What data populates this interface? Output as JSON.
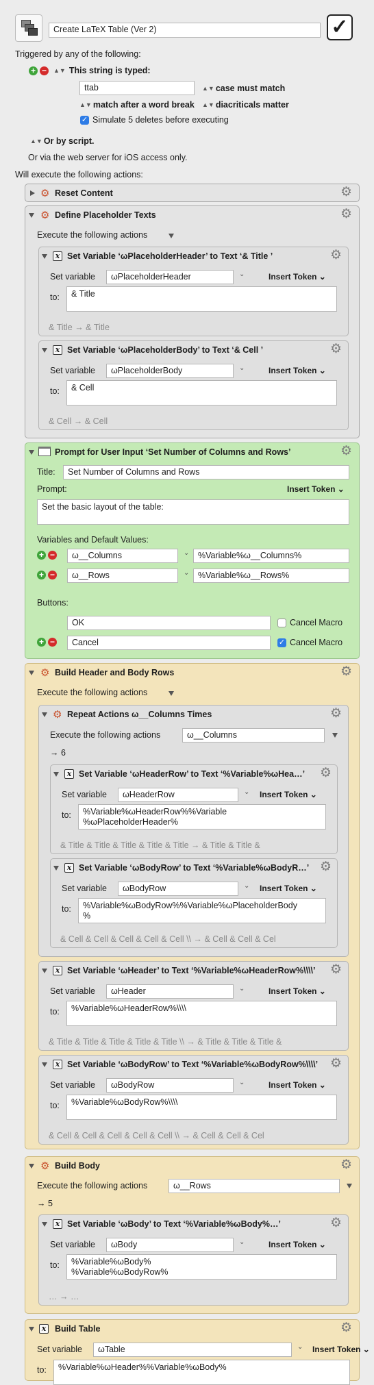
{
  "macro": {
    "name": "Create LaTeX Table (Ver 2)",
    "enabled": true
  },
  "triggers": {
    "header": "Triggered by any of the following:",
    "string_typed": "This string is typed:",
    "string": "ttab",
    "case": "case must match",
    "word_break": "match after a word break",
    "diacriticals": "diacriticals matter",
    "simulate": "Simulate 5 deletes before executing",
    "or_script": "Or by script.",
    "web": "Or via the web server for iOS access only."
  },
  "will_execute": "Will execute the following actions:",
  "insert_token": "Insert Token",
  "set_variable": "Set variable",
  "to_label": "to:",
  "execute_label": "Execute the following actions",
  "actions": {
    "reset": {
      "title": "Reset Content"
    },
    "define": {
      "title": "Define Placeholder Texts",
      "a1": {
        "title": "Set Variable ‘ωPlaceholderHeader’ to Text ‘& Title ’",
        "var": "ωPlaceholderHeader",
        "to": "& Title",
        "preview": "& Title  → & Title"
      },
      "a2": {
        "title": "Set Variable ‘ωPlaceholderBody’ to Text ‘& Cell ’",
        "var": "ωPlaceholderBody",
        "to": "& Cell",
        "preview": "& Cell  → & Cell"
      }
    },
    "prompt": {
      "title": "Prompt for User Input ‘Set Number of Columns and Rows’",
      "title_label": "Title:",
      "title_value": "Set Number of Columns and Rows",
      "prompt_label": "Prompt:",
      "prompt_value": "Set the basic layout of the table:",
      "vars_label": "Variables and Default Values:",
      "vars": [
        {
          "name": "ω__Columns",
          "default": "%Variable%ω__Columns%"
        },
        {
          "name": "ω__Rows",
          "default": "%Variable%ω__Rows%"
        }
      ],
      "buttons_label": "Buttons:",
      "buttons": [
        {
          "label": "OK",
          "cancel_label": "Cancel Macro",
          "cancel": false
        },
        {
          "label": "Cancel",
          "cancel_label": "Cancel Macro",
          "cancel": true
        }
      ]
    },
    "build_hb": {
      "title": "Build Header and Body Rows",
      "repeat": {
        "title": "Repeat Actions ω__Columns Times",
        "count_var": "ω__Columns",
        "result": "→ 6",
        "r1": {
          "title": "Set Variable ‘ωHeaderRow’ to Text ‘%Variable%ωHea…’",
          "var": "ωHeaderRow",
          "to": "%Variable%ωHeaderRow%%Variable\n%ωPlaceholderHeader%",
          "preview": "& Title & Title & Title & Title & Title  → & Title & Title &"
        },
        "r2": {
          "title": "Set Variable ‘ωBodyRow’ to Text ‘%Variable%ωBodyR…’",
          "var": "ωBodyRow",
          "to": "%Variable%ωBodyRow%%Variable%ωPlaceholderBody\n%",
          "preview": "& Cell & Cell & Cell & Cell & Cell \\\\ → & Cell & Cell & Cel"
        }
      },
      "h": {
        "title": "Set Variable ‘ωHeader’ to Text ‘%Variable%ωHeaderRow%\\\\\\\\’",
        "var": "ωHeader",
        "to": "%Variable%ωHeaderRow%\\\\\\\\",
        "preview": "& Title & Title & Title & Title & Title \\\\ → & Title & Title & Title &"
      },
      "b": {
        "title": "Set Variable ‘ωBodyRow’ to Text ‘%Variable%ωBodyRow%\\\\\\\\’",
        "var": "ωBodyRow",
        "to": "%Variable%ωBodyRow%\\\\\\\\",
        "preview": "& Cell & Cell & Cell & Cell & Cell \\\\ → & Cell & Cell & Cel"
      }
    },
    "build_body": {
      "title": "Build Body",
      "count_var": "ω__Rows",
      "result": "→ 5",
      "a": {
        "title": "Set Variable ‘ωBody’ to Text ‘%Variable%ωBody%…’",
        "var": "ωBody",
        "to": "%Variable%ωBody%\n%Variable%ωBodyRow%",
        "preview": "… → …"
      }
    },
    "build_table": {
      "title": "Build Table",
      "var": "ωTable",
      "to": "%Variable%ωHeader%%Variable%ωBody%"
    }
  }
}
